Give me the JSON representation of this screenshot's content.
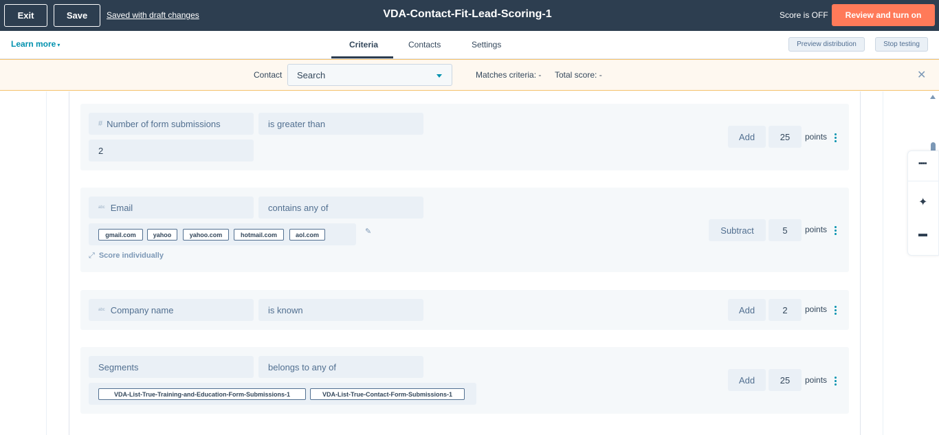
{
  "topbar": {
    "exit_label": "Exit",
    "save_label": "Save",
    "saved_status": "Saved with draft changes",
    "title": "VDA-Contact-Fit-Lead-Scoring-1",
    "score_status": "Score is OFF",
    "review_label": "Review and turn on"
  },
  "subnav": {
    "learn_more": "Learn more",
    "tabs": [
      {
        "label": "Criteria",
        "active": true
      },
      {
        "label": "Contacts",
        "active": false
      },
      {
        "label": "Settings",
        "active": false
      }
    ],
    "preview_label": "Preview distribution",
    "stop_label": "Stop testing"
  },
  "filter": {
    "contact_label": "Contact",
    "search_value": "Search",
    "matches_label": "Matches criteria: -",
    "total_label": "Total score: -"
  },
  "criteria": [
    {
      "property": "Number of form submissions",
      "property_icon": "#",
      "operator": "is greater than",
      "value": "2",
      "action": "Add",
      "points": "25",
      "points_label": "points"
    },
    {
      "property": "Email",
      "property_icon": "abc",
      "operator": "contains any of",
      "tags": [
        "gmail.com",
        "yahoo",
        "yahoo.com",
        "hotmail.com",
        "aol.com"
      ],
      "score_individually": "Score individually",
      "action": "Subtract",
      "points": "5",
      "points_label": "points"
    },
    {
      "property": "Company name",
      "property_icon": "abc",
      "operator": "is known",
      "action": "Add",
      "points": "2",
      "points_label": "points"
    },
    {
      "property": "Segments",
      "operator": "belongs to any of",
      "tags": [
        "VDA-List-True-Training-and-Education-Form-Submissions-1",
        "VDA-List-True-Contact-Form-Submissions-1"
      ],
      "action": "Add",
      "points": "25",
      "points_label": "points"
    }
  ],
  "colors": {
    "topbar": "#2d3e50",
    "accent": "#ff7a59",
    "link": "#0091ae",
    "filter_bg": "#fef8f0"
  }
}
